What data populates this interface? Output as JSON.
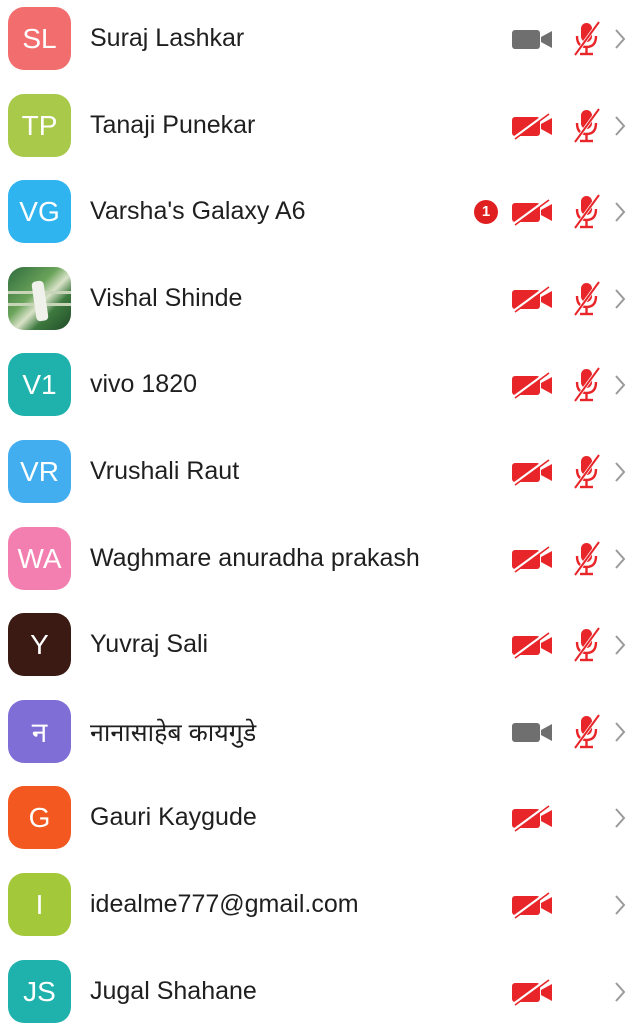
{
  "colors": {
    "red_icon": "#e8262a",
    "gray_icon": "#6f6f6f",
    "chevron": "#9a9a9a",
    "badge": "#e02020"
  },
  "participants": [
    {
      "initials": "SL",
      "name": "Suraj Lashkar",
      "avatar_color": "#f26d6d",
      "avatar_type": "initials",
      "video": "off-gray",
      "audio": "muted",
      "badge": ""
    },
    {
      "initials": "TP",
      "name": "Tanaji Punekar",
      "avatar_color": "#a9c94a",
      "avatar_type": "initials",
      "video": "off-red",
      "audio": "muted",
      "badge": ""
    },
    {
      "initials": "VG",
      "name": "Varsha's Galaxy A6",
      "avatar_color": "#2fb4f0",
      "avatar_type": "initials",
      "video": "off-red",
      "audio": "muted",
      "badge": "1"
    },
    {
      "initials": "",
      "name": "Vishal Shinde",
      "avatar_color": "#3f7f45",
      "avatar_type": "photo",
      "video": "off-red",
      "audio": "muted",
      "badge": ""
    },
    {
      "initials": "V1",
      "name": "vivo 1820",
      "avatar_color": "#1fb2ad",
      "avatar_type": "initials",
      "video": "off-red",
      "audio": "muted",
      "badge": ""
    },
    {
      "initials": "VR",
      "name": "Vrushali Raut",
      "avatar_color": "#42aef0",
      "avatar_type": "initials",
      "video": "off-red",
      "audio": "muted",
      "badge": ""
    },
    {
      "initials": "WA",
      "name": "Waghmare anuradha prakash",
      "avatar_color": "#f27fb0",
      "avatar_type": "initials",
      "video": "off-red",
      "audio": "muted",
      "badge": ""
    },
    {
      "initials": "Y",
      "name": "Yuvraj Sali",
      "avatar_color": "#3a1a12",
      "avatar_type": "initials",
      "video": "off-red",
      "audio": "muted",
      "badge": ""
    },
    {
      "initials": "न",
      "name": "नानासाहेब कायगुडे",
      "avatar_color": "#7f6ed6",
      "avatar_type": "initials",
      "video": "off-gray",
      "audio": "muted",
      "badge": ""
    },
    {
      "initials": "G",
      "name": "Gauri Kaygude",
      "avatar_color": "#f2581f",
      "avatar_type": "initials",
      "video": "off-red",
      "audio": "none",
      "badge": ""
    },
    {
      "initials": "I",
      "name": "idealme777@gmail.com",
      "avatar_color": "#a3c93a",
      "avatar_type": "initials",
      "video": "off-red",
      "audio": "none",
      "badge": ""
    },
    {
      "initials": "JS",
      "name": "Jugal Shahane",
      "avatar_color": "#1fb2ad",
      "avatar_type": "initials",
      "video": "off-red",
      "audio": "none",
      "badge": ""
    }
  ],
  "icons": {
    "video": "video-camera-off-icon",
    "audio": "microphone-muted-icon",
    "chevron": "chevron-right-icon"
  }
}
